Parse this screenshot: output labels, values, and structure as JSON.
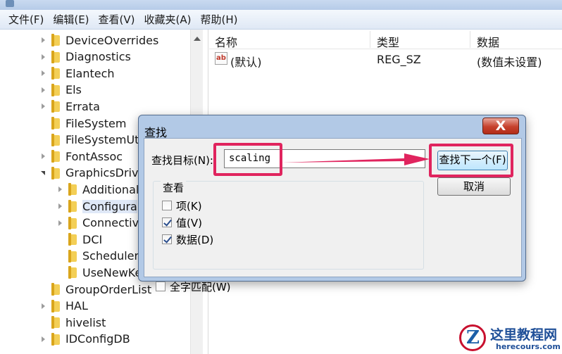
{
  "menu": [
    "文件(F)",
    "编辑(E)",
    "查看(V)",
    "收藏夹(A)",
    "帮助(H)"
  ],
  "tree": {
    "items": [
      {
        "label": "DeviceOverrides",
        "expander": "closed"
      },
      {
        "label": "Diagnostics",
        "expander": "closed"
      },
      {
        "label": "Elantech",
        "expander": "closed"
      },
      {
        "label": "Els",
        "expander": "closed"
      },
      {
        "label": "Errata",
        "expander": "closed"
      },
      {
        "label": "FileSystem",
        "expander": "none"
      },
      {
        "label": "FileSystemUti",
        "expander": "none"
      },
      {
        "label": "FontAssoc",
        "expander": "closed"
      },
      {
        "label": "GraphicsDrive",
        "expander": "open"
      },
      {
        "label": "Additional",
        "expander": "closed"
      },
      {
        "label": "Configura",
        "expander": "closed",
        "selected": true
      },
      {
        "label": "Connectivi",
        "expander": "closed"
      },
      {
        "label": "DCI",
        "expander": "none"
      },
      {
        "label": "Scheduler",
        "expander": "none"
      },
      {
        "label": "UseNewKe",
        "expander": "none"
      },
      {
        "label": "GroupOrderList",
        "expander": "none"
      },
      {
        "label": "HAL",
        "expander": "closed"
      },
      {
        "label": "hivelist",
        "expander": "none"
      },
      {
        "label": "IDConfigDB",
        "expander": "closed"
      }
    ]
  },
  "list": {
    "headers": {
      "name": "名称",
      "type": "类型",
      "data": "数据"
    },
    "rows": [
      {
        "icon_text": "ab",
        "name": "(默认)",
        "type": "REG_SZ",
        "data": "(数值未设置)"
      }
    ]
  },
  "dialog": {
    "title": "查找",
    "close_glyph": "X",
    "find_label": "查找目标(N):",
    "find_value": "scaling",
    "find_next": "查找下一个(F)",
    "cancel": "取消",
    "look_at": {
      "title": "查看",
      "options": [
        {
          "label": "项(K)",
          "checked": false
        },
        {
          "label": "值(V)",
          "checked": true
        },
        {
          "label": "数据(D)",
          "checked": true
        }
      ]
    },
    "whole_word": {
      "label": "全字匹配(W)",
      "checked": false
    }
  },
  "watermark": {
    "cn": "这里教程网",
    "en": "herecours.com"
  },
  "colors": {
    "highlight": "#e0245e",
    "close_button": "#c6412d",
    "title_gradient": "#b2c9e6"
  }
}
